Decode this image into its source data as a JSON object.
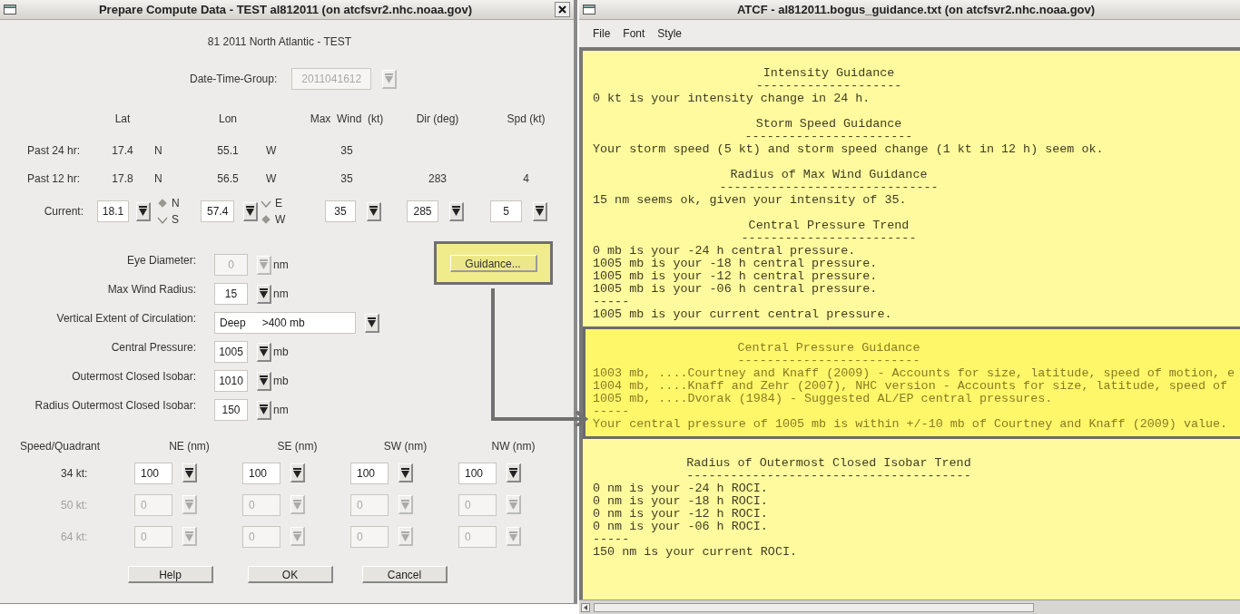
{
  "left_window": {
    "title": "Prepare Compute Data - TEST al812011 (on atcfsvr2.nhc.noaa.gov)",
    "storm_name": "81 2011 North Atlantic - TEST",
    "date_time_group": {
      "label": "Date-Time-Group:",
      "value": "2011041612",
      "disabled": true
    },
    "track_columns": [
      "Lat",
      "Lon",
      "Max  Wind  (kt)",
      "Dir (deg)",
      "Spd (kt)"
    ],
    "past_rows": [
      {
        "label": "Past 24 hr:",
        "lat": "17.4",
        "lat_hemisphere": "N",
        "lon": "55.1",
        "lon_hemisphere": "W",
        "max_wind": "35"
      },
      {
        "label": "Past 12 hr:",
        "lat": "17.8",
        "lat_hemisphere": "N",
        "lon": "56.5",
        "lon_hemisphere": "W",
        "max_wind": "35",
        "dir": "283",
        "spd": "4"
      }
    ],
    "current": {
      "label": "Current:",
      "lat": "18.1",
      "lat_hemispheres": [
        {
          "label": "N",
          "selected": true
        },
        {
          "label": "S",
          "selected": false
        }
      ],
      "lon": "57.4",
      "lon_hemispheres": [
        {
          "label": "E",
          "selected": false
        },
        {
          "label": "W",
          "selected": true
        }
      ],
      "max_wind": "35",
      "dir": "285",
      "spd": "5"
    },
    "fields": [
      {
        "kind": "number",
        "label": "Eye Diameter:",
        "value": "0",
        "unit": "nm",
        "disabled": true
      },
      {
        "kind": "number",
        "label": "Max Wind Radius:",
        "value": "15",
        "unit": "nm",
        "disabled": false
      },
      {
        "kind": "select",
        "label": "Vertical Extent of Circulation:",
        "value": "Deep",
        "detail": ">400 mb",
        "disabled": false
      },
      {
        "kind": "number",
        "label": "Central Pressure:",
        "value": "1005",
        "unit": "mb",
        "disabled": false
      },
      {
        "kind": "number",
        "label": "Outermost Closed Isobar:",
        "value": "1010",
        "unit": "mb",
        "disabled": false
      },
      {
        "kind": "number",
        "label": "Radius Outermost Closed Isobar:",
        "value": "150",
        "unit": "nm",
        "disabled": false
      }
    ],
    "guidance_button": {
      "label": "Guidance...",
      "highlighted": true
    },
    "quadrants": {
      "header": "Speed/Quadrant",
      "columns": [
        "NE (nm)",
        "SE (nm)",
        "SW (nm)",
        "NW (nm)"
      ],
      "rows": [
        {
          "label": "34 kt:",
          "disabled": false,
          "values": [
            "100",
            "100",
            "100",
            "100"
          ]
        },
        {
          "label": "50 kt:",
          "disabled": true,
          "values": [
            "0",
            "0",
            "0",
            "0"
          ]
        },
        {
          "label": "64 kt:",
          "disabled": true,
          "values": [
            "0",
            "0",
            "0",
            "0"
          ]
        }
      ]
    },
    "buttons": [
      "Help",
      "OK",
      "Cancel"
    ]
  },
  "right_window": {
    "title": "ATCF - al812011.bogus_guidance.txt (on atcfsvr2.nhc.noaa.gov)",
    "menu": [
      {
        "label": "File"
      },
      {
        "label": "Font"
      },
      {
        "label": "Style"
      }
    ],
    "sections": [
      {
        "title": "Intensity Guidance",
        "rule": "--------------------",
        "highlighted": false,
        "lines": [
          "0 kt is your intensity change in 24 h."
        ]
      },
      {
        "title": "Storm Speed Guidance",
        "rule": "-----------------------",
        "highlighted": false,
        "lines": [
          "Your storm speed (5 kt) and storm speed change (1 kt in 12 h) seem ok."
        ]
      },
      {
        "title": "Radius of Max Wind Guidance",
        "rule": "------------------------------",
        "highlighted": false,
        "lines": [
          "15 nm seems ok, given your intensity of 35."
        ]
      },
      {
        "title": "Central Pressure Trend",
        "rule": "------------------------",
        "highlighted": false,
        "lines": [
          "0 mb is your -24 h central pressure.",
          "1005 mb is your -18 h central pressure.",
          "1005 mb is your -12 h central pressure.",
          "1005 mb is your -06 h central pressure.",
          "-----",
          "1005 mb is your current central pressure."
        ]
      },
      {
        "title": "Central Pressure Guidance",
        "rule": "-------------------------",
        "highlighted": true,
        "lines": [
          "1003 mb, ....Courtney and Knaff (2009) - Accounts for size, latitude, speed of motion, e",
          "1004 mb, ....Knaff and Zehr (2007), NHC version - Accounts for size, latitude, speed of",
          "1005 mb, ....Dvorak (1984) - Suggested AL/EP central pressures.",
          "-----",
          "Your central pressure of 1005 mb is within +/-10 mb of Courtney and Knaff (2009) value."
        ]
      },
      {
        "title": "Radius of Outermost Closed Isobar Trend",
        "rule": "---------------------------------------",
        "highlighted": false,
        "lines": [
          "0 nm is your -24 h ROCI.",
          "0 nm is your -18 h ROCI.",
          "0 nm is your -12 h ROCI.",
          "0 nm is your -06 h ROCI.",
          "-----",
          "150 nm is your current ROCI."
        ]
      }
    ]
  }
}
